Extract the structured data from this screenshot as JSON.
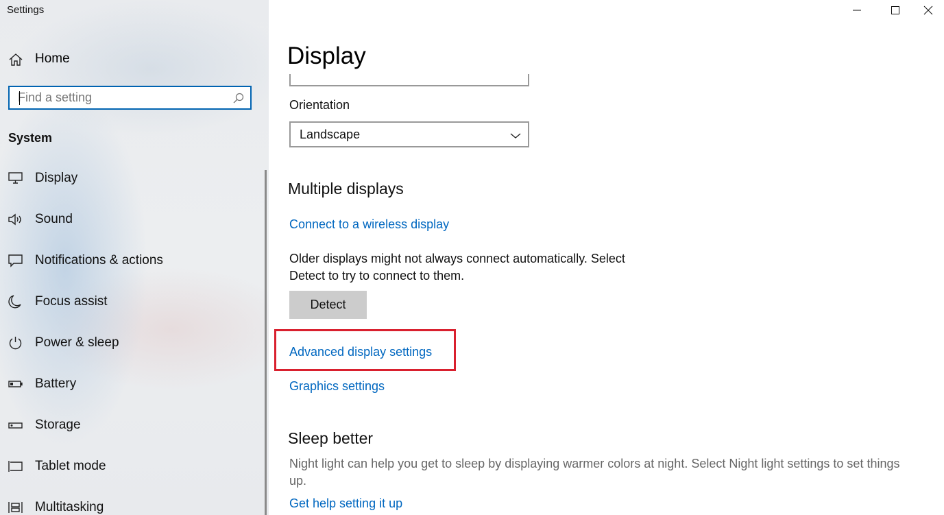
{
  "window": {
    "title": "Settings",
    "controls": [
      "minimize",
      "maximize",
      "close"
    ]
  },
  "sidebar": {
    "home_label": "Home",
    "search": {
      "placeholder": "Find a setting",
      "value": ""
    },
    "section_title": "System",
    "items": [
      {
        "label": "Display",
        "icon": "monitor-icon"
      },
      {
        "label": "Sound",
        "icon": "speaker-icon"
      },
      {
        "label": "Notifications & actions",
        "icon": "message-icon"
      },
      {
        "label": "Focus assist",
        "icon": "moon-icon"
      },
      {
        "label": "Power & sleep",
        "icon": "power-icon"
      },
      {
        "label": "Battery",
        "icon": "battery-icon"
      },
      {
        "label": "Storage",
        "icon": "storage-icon"
      },
      {
        "label": "Tablet mode",
        "icon": "tablet-mode-icon"
      },
      {
        "label": "Multitasking",
        "icon": "multitasking-icon"
      }
    ]
  },
  "main": {
    "page_title": "Display",
    "orientation": {
      "label": "Orientation",
      "value": "Landscape"
    },
    "multiple_displays": {
      "heading": "Multiple displays",
      "connect_link": "Connect to a wireless display",
      "description_line1": "Older displays might not always connect automatically. Select",
      "description_line2": "Detect to try to connect to them.",
      "detect_button": "Detect",
      "advanced_link": "Advanced display settings",
      "graphics_link": "Graphics settings"
    },
    "sleep_better": {
      "heading": "Sleep better",
      "description_line1": "Night light can help you get to sleep by displaying warmer colors at night. Select Night light settings to set things",
      "description_line2": "up.",
      "help_link": "Get help setting it up"
    }
  },
  "colors": {
    "accent": "#0067c0",
    "highlight_box": "#d9202e",
    "button_bg": "#cccccc"
  }
}
